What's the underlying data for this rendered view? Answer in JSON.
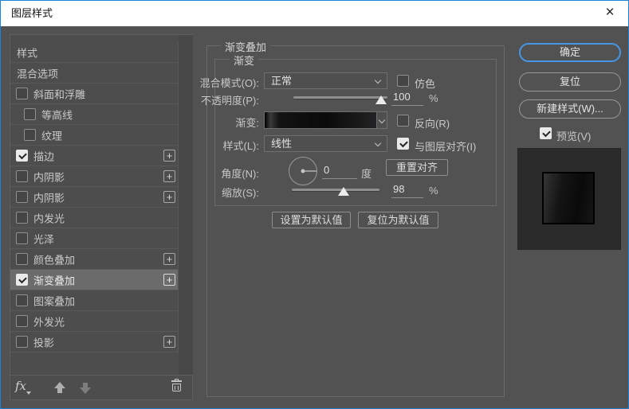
{
  "window": {
    "title": "图层样式"
  },
  "icons": {
    "close": "×",
    "plus": "+",
    "fx": "fx",
    "dropdown": "chevron-down",
    "move_up": "arrow-up",
    "move_down": "arrow-down",
    "delete": "trash"
  },
  "colors": {
    "window_border": "#1e82d2",
    "titlebar_bg": "#ffffff",
    "dialog_bg": "#525252",
    "panel_row_bg": "#4d4d4d",
    "selected_row_bg": "#6b6b6b",
    "focus_accent": "#4796e4",
    "checkbox_checked_bg": "#e9e9e9",
    "text": "#c9c9c9"
  },
  "sidebar": {
    "items": [
      {
        "label": "样式",
        "checkbox": false
      },
      {
        "label": "混合选项",
        "checkbox": false
      },
      {
        "label": "斜面和浮雕",
        "checkbox": true,
        "checked": false
      },
      {
        "label": "等高线",
        "checkbox": true,
        "checked": false,
        "indent": true
      },
      {
        "label": "纹理",
        "checkbox": true,
        "checked": false,
        "indent": true
      },
      {
        "label": "描边",
        "checkbox": true,
        "checked": true,
        "add_button": true
      },
      {
        "label": "内阴影",
        "checkbox": true,
        "checked": false,
        "add_button": true
      },
      {
        "label": "内阴影",
        "checkbox": true,
        "checked": false,
        "add_button": true
      },
      {
        "label": "内发光",
        "checkbox": true,
        "checked": false
      },
      {
        "label": "光泽",
        "checkbox": true,
        "checked": false
      },
      {
        "label": "颜色叠加",
        "checkbox": true,
        "checked": false,
        "add_button": true
      },
      {
        "label": "渐变叠加",
        "checkbox": true,
        "checked": true,
        "add_button": true,
        "selected": true
      },
      {
        "label": "图案叠加",
        "checkbox": true,
        "checked": false
      },
      {
        "label": "外发光",
        "checkbox": true,
        "checked": false
      },
      {
        "label": "投影",
        "checkbox": true,
        "checked": false,
        "add_button": true
      }
    ]
  },
  "main": {
    "group_title": "渐变叠加",
    "subgroup_title": "渐变",
    "blend_mode_label": "混合模式(O):",
    "blend_mode_value": "正常",
    "dither_label": "仿色",
    "dither_checked": false,
    "opacity_label": "不透明度(P):",
    "opacity_value": "100",
    "opacity_unit": "%",
    "gradient_label": "渐变:",
    "reverse_label": "反向(R)",
    "reverse_checked": false,
    "style_label": "样式(L):",
    "style_value": "线性",
    "align_label": "与图层对齐(I)",
    "align_checked": true,
    "angle_label": "角度(N):",
    "angle_value": "0",
    "angle_unit": "度",
    "reset_align_button": "重置对齐",
    "scale_label": "缩放(S):",
    "scale_value": "98",
    "scale_unit": "%",
    "make_default_button": "设置为默认值",
    "reset_default_button": "复位为默认值"
  },
  "actions": {
    "ok": "确定",
    "reset": "复位",
    "new_style": "新建样式(W)...",
    "preview_label": "预览(V)",
    "preview_checked": true
  }
}
